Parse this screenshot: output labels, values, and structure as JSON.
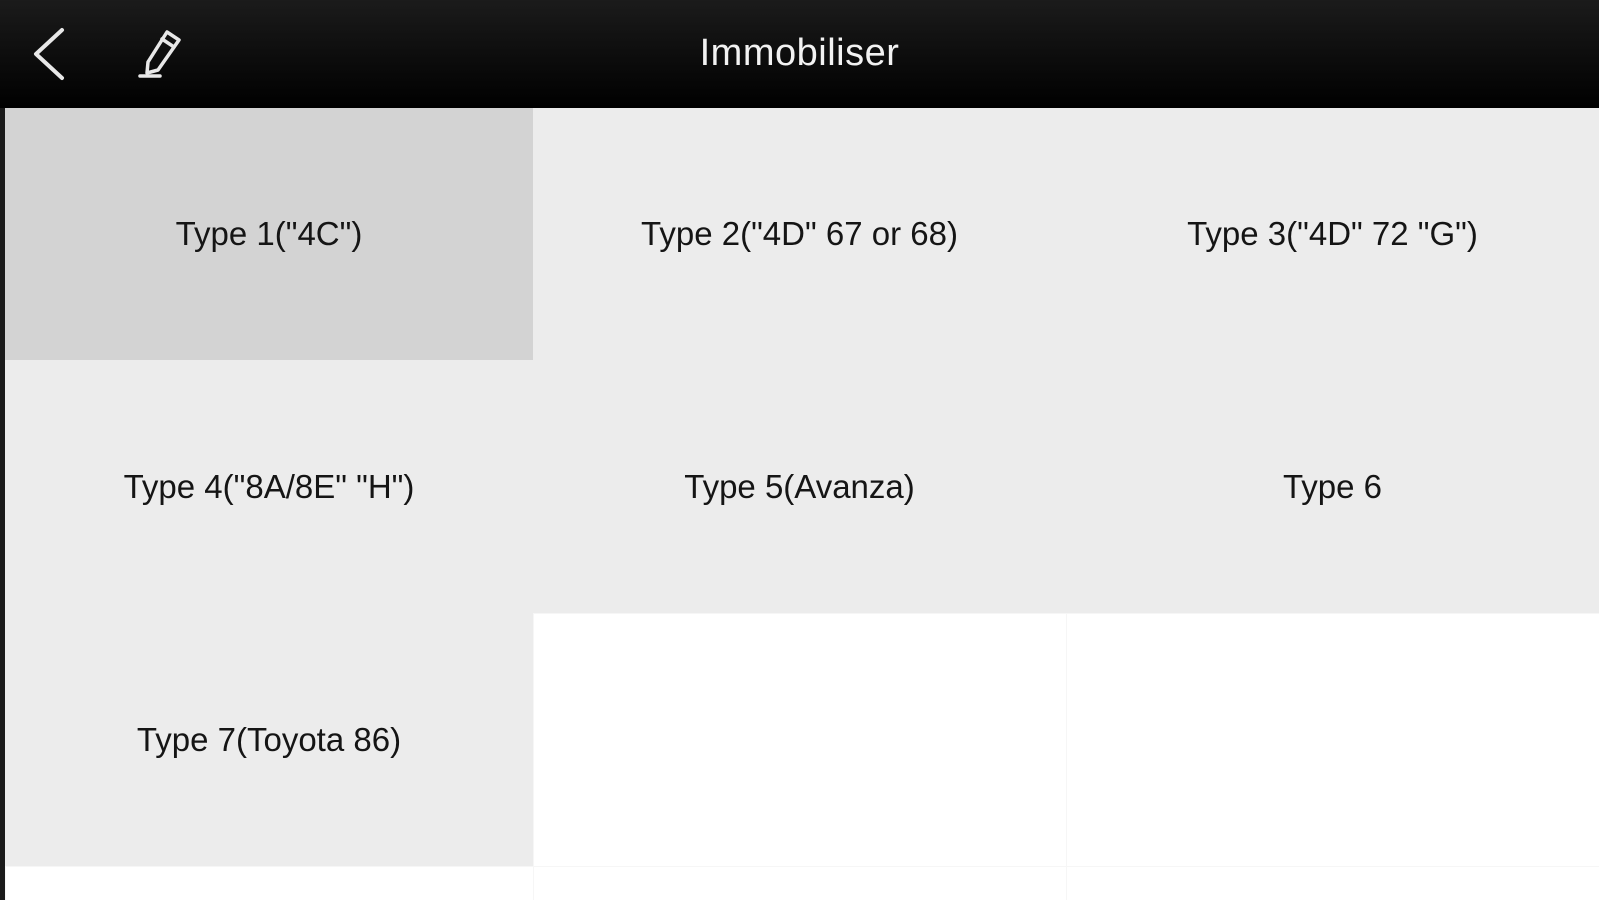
{
  "header": {
    "title": "Immobiliser",
    "back_icon": "chevron-left-icon",
    "edit_icon": "pencil-icon"
  },
  "colors": {
    "header_bg": "#000000",
    "selected_cell": "#d3d3d3",
    "cell": "#ececec",
    "empty_cell": "#ffffff"
  },
  "types": [
    {
      "label": "Type 1(\"4C\")",
      "selected": true
    },
    {
      "label": "Type 2(\"4D\" 67 or 68)",
      "selected": false
    },
    {
      "label": "Type 3(\"4D\" 72 \"G\")",
      "selected": false
    },
    {
      "label": "Type 4(\"8A/8E\" \"H\")",
      "selected": false
    },
    {
      "label": "Type 5(Avanza)",
      "selected": false
    },
    {
      "label": "Type 6",
      "selected": false
    },
    {
      "label": "Type 7(Toyota 86)",
      "selected": false
    }
  ]
}
